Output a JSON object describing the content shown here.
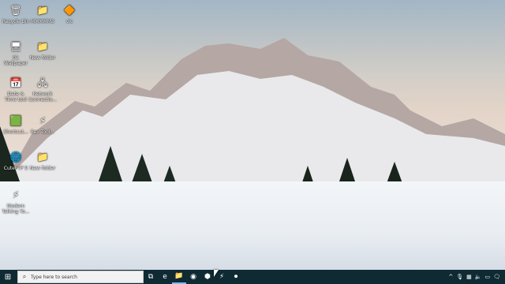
{
  "desktop": {
    "icons": [
      {
        "name": "recycle-bin",
        "label": "Recycle Bin",
        "glyph": "🗑"
      },
      {
        "name": "folder-1",
        "label": "MMMMM3",
        "glyph": "📁"
      },
      {
        "name": "vlc",
        "label": "vlc",
        "glyph": "🔶"
      },
      {
        "name": "wallpaper-folder",
        "label": "01 Wallpaper",
        "glyph": "🖥"
      },
      {
        "name": "folder-2",
        "label": "New folder",
        "glyph": "📁"
      },
      {
        "name": "date-time-tool",
        "label": "Date & Time tool",
        "glyph": "📅"
      },
      {
        "name": "network-connections",
        "label": "Network Connectio...",
        "glyph": "🖧"
      },
      {
        "name": "shortcut-app",
        "label": "Shortcut...",
        "glyph": "🟩"
      },
      {
        "name": "rev-tool",
        "label": "Rev Tool...",
        "glyph": "⚡"
      },
      {
        "name": "cuteftp",
        "label": "CuteFTP 9",
        "glyph": "🌐"
      },
      {
        "name": "new-folder",
        "label": "New folder",
        "glyph": "📁"
      },
      {
        "name": "modern-talking",
        "label": "Modern Talking Yo...",
        "glyph": "⚡"
      }
    ]
  },
  "taskbar": {
    "search_placeholder": "Type here to search",
    "pinned": [
      {
        "name": "task-view-icon",
        "glyph": "⧉"
      },
      {
        "name": "edge-icon",
        "glyph": "e"
      },
      {
        "name": "file-explorer-icon",
        "glyph": "📁"
      },
      {
        "name": "chrome-icon",
        "glyph": "◉"
      },
      {
        "name": "app-icon-1",
        "glyph": "⬢"
      },
      {
        "name": "app-icon-2",
        "glyph": "⚡"
      },
      {
        "name": "app-icon-3",
        "glyph": "⏺"
      }
    ],
    "tray": {
      "chevron": "^",
      "mic": "🎙",
      "network": "▦",
      "volume": "🔈",
      "battery": "▭",
      "notifications": "🗨"
    }
  }
}
